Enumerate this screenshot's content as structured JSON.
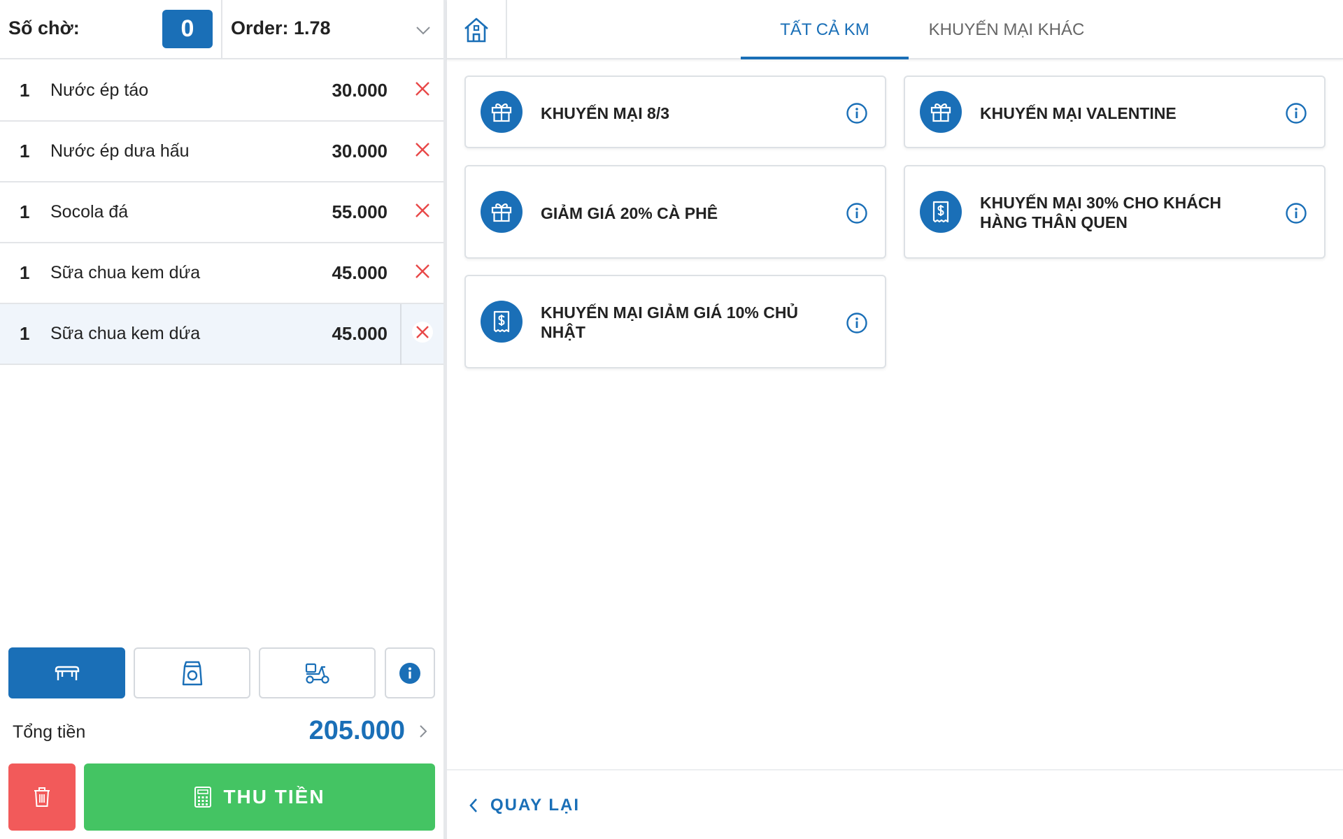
{
  "header": {
    "waiting_label": "Số chờ:",
    "waiting_count": "0",
    "order_label": "Order: 1.78"
  },
  "order_items": [
    {
      "qty": "1",
      "name": "Nước ép táo",
      "price": "30.000"
    },
    {
      "qty": "1",
      "name": "Nước ép dưa hấu",
      "price": "30.000"
    },
    {
      "qty": "1",
      "name": "Socola đá",
      "price": "55.000"
    },
    {
      "qty": "1",
      "name": "Sữa chua kem dứa",
      "price": "45.000"
    },
    {
      "qty": "1",
      "name": "Sữa chua kem dứa",
      "price": "45.000"
    }
  ],
  "order_types": [
    {
      "icon": "table-icon",
      "active": true
    },
    {
      "icon": "takeaway-bag-icon",
      "active": false
    },
    {
      "icon": "delivery-scooter-icon",
      "active": false
    },
    {
      "icon": "info-icon",
      "active": false
    }
  ],
  "total": {
    "label": "Tổng tiền",
    "value": "205.000"
  },
  "actions": {
    "delete_icon": "trash-icon",
    "pay_label": "THU TIỀN",
    "pay_icon": "calculator-icon"
  },
  "tabs": [
    {
      "label": "TẤT CẢ KM",
      "active": true
    },
    {
      "label": "KHUYẾN MẠI KHÁC",
      "active": false
    }
  ],
  "promotions": [
    {
      "title": "KHUYẾN MẠI 8/3",
      "icon": "gift-icon"
    },
    {
      "title": "KHUYẾN MẠI VALENTINE",
      "icon": "gift-icon"
    },
    {
      "title": "GIẢM GIÁ 20% CÀ PHÊ",
      "icon": "gift-icon"
    },
    {
      "title": "KHUYẾN MẠI 30% CHO KHÁCH HÀNG THÂN QUEN",
      "icon": "receipt-dollar-icon"
    },
    {
      "title": "KHUYẾN MẠI GIẢM GIÁ 10% CHỦ NHẬT",
      "icon": "receipt-dollar-icon"
    }
  ],
  "footer": {
    "back_label": "QUAY LẠI"
  },
  "colors": {
    "primary": "#1a6fb7",
    "pay_green": "#44c463",
    "delete_red": "#f25a5a",
    "remove_x": "#e84848"
  }
}
